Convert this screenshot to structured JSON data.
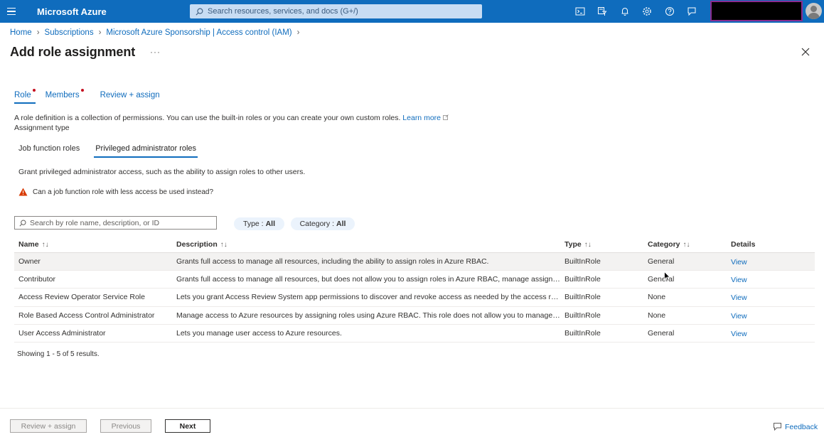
{
  "topbar": {
    "brand": "Microsoft Azure",
    "search_placeholder": "Search resources, services, and docs (G+/)",
    "icons": [
      "cloud-shell-icon",
      "directory-filter-icon",
      "notifications-icon",
      "settings-icon",
      "help-icon",
      "feedback-icon"
    ]
  },
  "breadcrumb": [
    "Home",
    "Subscriptions",
    "Microsoft Azure Sponsorship | Access control (IAM)"
  ],
  "page": {
    "title": "Add role assignment",
    "more": "···"
  },
  "tabs": [
    {
      "label": "Role",
      "required": true,
      "active": true
    },
    {
      "label": "Members",
      "required": true,
      "active": false
    },
    {
      "label": "Review + assign",
      "required": false,
      "active": false
    }
  ],
  "intro": {
    "text": "A role definition is a collection of permissions. You can use the built-in roles or you can create your own custom roles.",
    "learn_more": "Learn more",
    "assignment_type": "Assignment type"
  },
  "subtabs": [
    {
      "label": "Job function roles",
      "active": false
    },
    {
      "label": "Privileged administrator roles",
      "active": true
    }
  ],
  "grant_text": "Grant privileged administrator access, such as the ability to assign roles to other users.",
  "warning_text": "Can a job function role with less access be used instead?",
  "filters": {
    "search_placeholder": "Search by role name, description, or ID",
    "type_label": "Type :",
    "type_value": "All",
    "category_label": "Category :",
    "category_value": "All"
  },
  "table": {
    "headers": {
      "name": "Name",
      "description": "Description",
      "type": "Type",
      "category": "Category",
      "details": "Details"
    },
    "rows": [
      {
        "name": "Owner",
        "description": "Grants full access to manage all resources, including the ability to assign roles in Azure RBAC.",
        "type": "BuiltInRole",
        "category": "General",
        "details": "View"
      },
      {
        "name": "Contributor",
        "description": "Grants full access to manage all resources, but does not allow you to assign roles in Azure RBAC, manage assignment...",
        "type": "BuiltInRole",
        "category": "General",
        "details": "View"
      },
      {
        "name": "Access Review Operator Service Role",
        "description": "Lets you grant Access Review System app permissions to discover and revoke access as needed by the access review ...",
        "type": "BuiltInRole",
        "category": "None",
        "details": "View"
      },
      {
        "name": "Role Based Access Control Administrator",
        "description": "Manage access to Azure resources by assigning roles using Azure RBAC. This role does not allow you to manage acce...",
        "type": "BuiltInRole",
        "category": "None",
        "details": "View"
      },
      {
        "name": "User Access Administrator",
        "description": "Lets you manage user access to Azure resources.",
        "type": "BuiltInRole",
        "category": "General",
        "details": "View"
      }
    ]
  },
  "showing": "Showing 1 - 5 of 5 results.",
  "footer": {
    "review_assign": "Review + assign",
    "previous": "Previous",
    "next": "Next",
    "feedback": "Feedback"
  }
}
